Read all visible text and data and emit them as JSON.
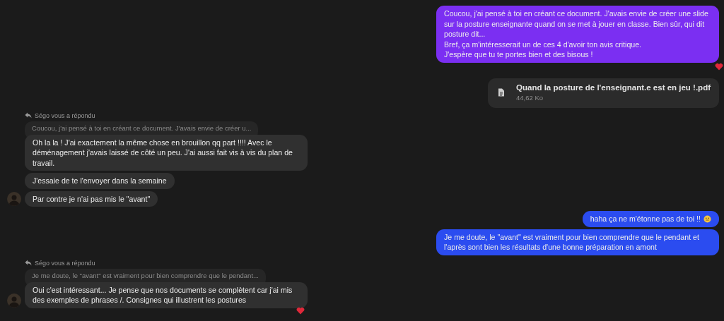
{
  "groups": [
    {
      "kind": "outgoing",
      "messages": [
        {
          "kind": "text",
          "color": "#7b2ff2",
          "reacted": true,
          "lines": [
            "Coucou, j'ai pensé à toi en créant ce document. J'avais envie de créer une slide sur la posture enseignante quand on se met à jouer en classe. Bien sûr, qui dit posture dit...",
            "Bref, ça m'intéresserait un de ces 4 d'avoir ton avis critique.",
            "J'espère que tu te portes bien et des bisous !"
          ]
        },
        {
          "kind": "file",
          "name": "Quand la posture de l'enseignant.e est en jeu !.pdf",
          "size": "44,62 Ko"
        }
      ]
    },
    {
      "kind": "incoming",
      "reply_label": "Ségo vous a répondu",
      "quote": "Coucou, j'ai pensé à toi en créant ce document. J'avais envie de créer u...",
      "messages": [
        {
          "kind": "text",
          "reacted": false,
          "lines": [
            "Oh la la ! J'ai exactement la même chose en brouillon qq part !!!! Avec le déménagement j'avais laissé de côté un peu. J'ai aussi fait vis à vis du plan de travail."
          ]
        },
        {
          "kind": "text",
          "reacted": false,
          "lines": [
            "J'essaie de te l'envoyer dans la semaine"
          ]
        },
        {
          "kind": "text",
          "reacted": false,
          "lines": [
            "Par contre je n'ai pas mis le \"avant\""
          ]
        }
      ]
    },
    {
      "kind": "outgoing",
      "messages": [
        {
          "kind": "text",
          "color": "#2b4cf0",
          "reacted": false,
          "emoji": true,
          "lines": [
            "haha ça ne m'étonne pas de toi !!"
          ]
        },
        {
          "kind": "text",
          "color": "#2b4cf0",
          "reacted": false,
          "lines": [
            "Je me doute, le \"avant\" est vraiment pour bien comprendre que le pendant et l'après sont bien les résultats d'une bonne préparation en amont"
          ]
        }
      ]
    },
    {
      "kind": "incoming",
      "reply_label": "Ségo vous a répondu",
      "quote": "Je me doute, le \"avant\" est vraiment pour bien comprendre que le pendant...",
      "messages": [
        {
          "kind": "text",
          "reacted": true,
          "lines": [
            "Oui c'est intéressant... Je pense que nos documents se complètent car j'ai mis des exemples de phrases /. Consignes qui illustrent les postures"
          ]
        }
      ]
    }
  ]
}
